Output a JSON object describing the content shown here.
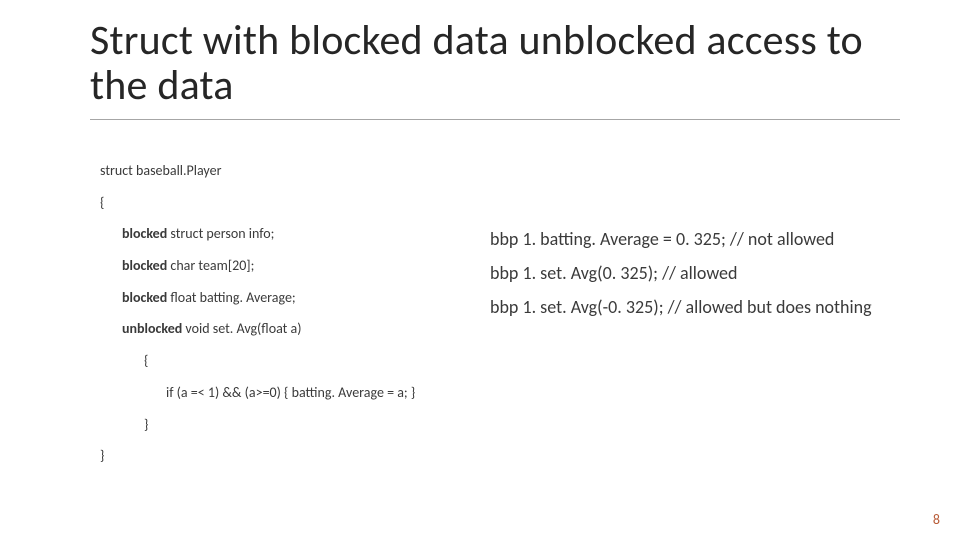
{
  "slide": {
    "title": "Struct with blocked data unblocked access to the data",
    "page_number": "8"
  },
  "code": {
    "l01": "struct baseball.Player",
    "l02": "{",
    "l03_kw": "blocked",
    "l03_rest": " struct person info;",
    "l04_kw": "blocked",
    "l04_rest": " char team[20];",
    "l05_kw": "blocked",
    "l05_rest": " float batting. Average;",
    "l06_kw": "unblocked",
    "l06_rest": " void set. Avg(float a)",
    "l07": "{",
    "l08": "if (a =< 1) && (a>=0) { batting. Average = a; }",
    "l09": "}",
    "l10": "}"
  },
  "examples": {
    "e1": "bbp 1. batting. Average = 0. 325;  // not allowed",
    "e2": "bbp 1. set. Avg(0. 325); // allowed",
    "e3": "bbp 1. set. Avg(-0. 325); // allowed but does nothing"
  }
}
